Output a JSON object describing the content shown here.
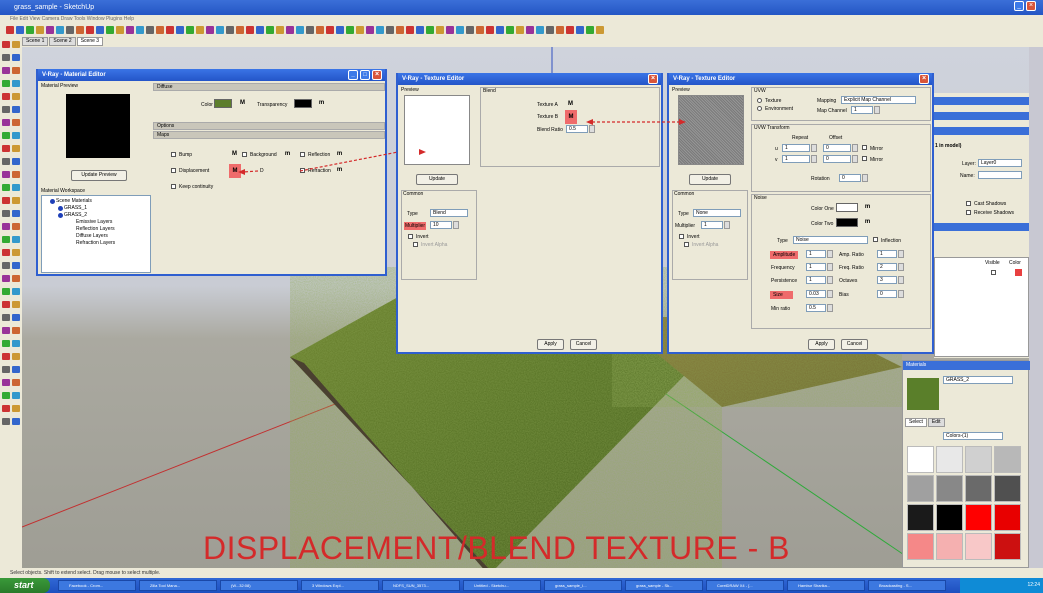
{
  "app": {
    "title": "grass_sample - SketchUp",
    "menu": "File  Edit  View  Camera  Draw  Tools  Window  Plugins  Help",
    "scenes": [
      "Scene 1",
      "Scene 2",
      "Scene 3"
    ]
  },
  "material_editor": {
    "title": "V-Ray - Material Editor",
    "preview_label": "Material Preview",
    "update_button": "Update Preview",
    "workspace_label": "Material Workspace",
    "tree": [
      "Scene Materials",
      "GRASS_1",
      "GRASS_2",
      "Emissive Layers",
      "Reflection Layers",
      "Diffuse Layers",
      "Refraction Layers"
    ],
    "diffuse_header": "Diffuse",
    "color_label": "Color",
    "transparency_label": "Transparency",
    "options_header": "Options",
    "maps_header": "Maps",
    "maps": [
      "Bump",
      "Displacement",
      "Keep continuity"
    ],
    "background_label": "Background",
    "reflection_label": "Reflection",
    "refraction_label": "Refraction",
    "m": "M",
    "m_lower": "m",
    "d": "D"
  },
  "texture_editor_b": {
    "title": "V-Ray - Texture Editor",
    "preview_label": "Preview",
    "blend_label": "Blend",
    "texture_a": "Texture A",
    "texture_b": "Texture B",
    "blend_ratio_label": "Blend Ratio",
    "blend_ratio": "0.5",
    "update_button": "Update",
    "common_label": "Common",
    "type_label": "Type",
    "type_value": "Blend",
    "multiplier_label": "Multiplier",
    "multiplier_value": "10",
    "invert_label": "Invert",
    "invert_alpha_label": "Invert Alpha",
    "apply": "Apply",
    "cancel": "Cancel"
  },
  "texture_editor_noise": {
    "title": "V-Ray - Texture Editor",
    "preview_label": "Preview",
    "uvw_label": "UVW",
    "texture_radio": "Texture",
    "environment_radio": "Environment",
    "mapping_label": "Mapping",
    "mapping_value": "Explicit Map Channel",
    "map_channel_label": "Map Channel",
    "map_channel_value": "1",
    "uvw_transform_label": "UVW Transform",
    "repeat_label": "Repeat",
    "offset_label": "Offset",
    "u_label": "u",
    "v_label": "v",
    "u_repeat": "1",
    "u_offset": "0",
    "v_repeat": "1",
    "v_offset": "0",
    "mirror_label": "Mirror",
    "rotation_label": "Rotation",
    "rotation_value": "0",
    "update_button": "Update",
    "common_label": "Common",
    "type_label": "Type",
    "type_value": "None",
    "multiplier_label": "Multiplier",
    "multiplier_value": "1",
    "invert_label": "Invert",
    "invert_alpha_label": "Invert Alpha",
    "noise_label": "Noise",
    "color_one": "Color One",
    "color_two": "Color Two",
    "noise_type_label": "Type",
    "noise_type_value": "Noise",
    "inflection_label": "Inflection",
    "amplitude_label": "Amplitude",
    "amplitude_value": "1",
    "amp_ratio_label": "Amp. Ratio",
    "amp_ratio_value": "1",
    "frequency_label": "Frequency",
    "frequency_value": "1",
    "freq_ratio_label": "Freq. Ratio",
    "freq_ratio_value": "2",
    "persistence_label": "Persistence",
    "persistence_value": "1",
    "octaves_label": "Octaves",
    "octaves_value": "3",
    "size_label": "Size",
    "size_value": "0.03",
    "bias_label": "Bias",
    "bias_value": "0",
    "min_ratio_label": "Min ratio",
    "min_ratio_value": "0.5",
    "apply": "Apply",
    "cancel": "Cancel"
  },
  "side_panel": {
    "in_model": "1 in model)",
    "layer_label": "Layer:",
    "layer_value": "Layer0",
    "name_label": "Name:",
    "cast_shadows": "Cast Shadows",
    "receive_shadows": "Receive Shadows",
    "visible_col": "Visible",
    "color_col": "Color"
  },
  "materials_panel": {
    "title": "Materials",
    "material_name": "GRASS_2",
    "select_tab": "Select",
    "edit_tab": "Edit",
    "dropdown": "Colors-(1)",
    "colors": [
      "#ffffff",
      "#e8e8e8",
      "#d0d0d0",
      "#b8b8b8",
      "#a0a0a0",
      "#888888",
      "#6a6a6a",
      "#505050",
      "#1a1a1a",
      "#000000",
      "#ff0000",
      "#e80000",
      "#f58888",
      "#f5b0b0",
      "#f8c8c8",
      "#cc1010"
    ]
  },
  "status": "Select objects. Shift to extend select. Drag mouse to select multiple.",
  "taskbar": {
    "start": "start",
    "items": [
      "Facebook - Crom...",
      "Zilla Tool Mana...",
      "(W...32:08)",
      "3 Windows Expl...",
      "NDFS_SUN_3573...",
      "Untitled - Sketchu...",
      "grass_sample_I...",
      "grass_sample - Sk...",
      "CorelDRAW X4 - [...",
      "Hambur Sharika...",
      "Broadcasting - S..."
    ],
    "clock": "12:24"
  },
  "overlay_text": "DISPLACEMENT/BLEND TEXTURE - B",
  "colors": {
    "diffuse_swatch": "#5d7e2c",
    "transparency_swatch": "#000000",
    "highlight": "#ef6b6b",
    "arrow": "#d42a2a"
  }
}
